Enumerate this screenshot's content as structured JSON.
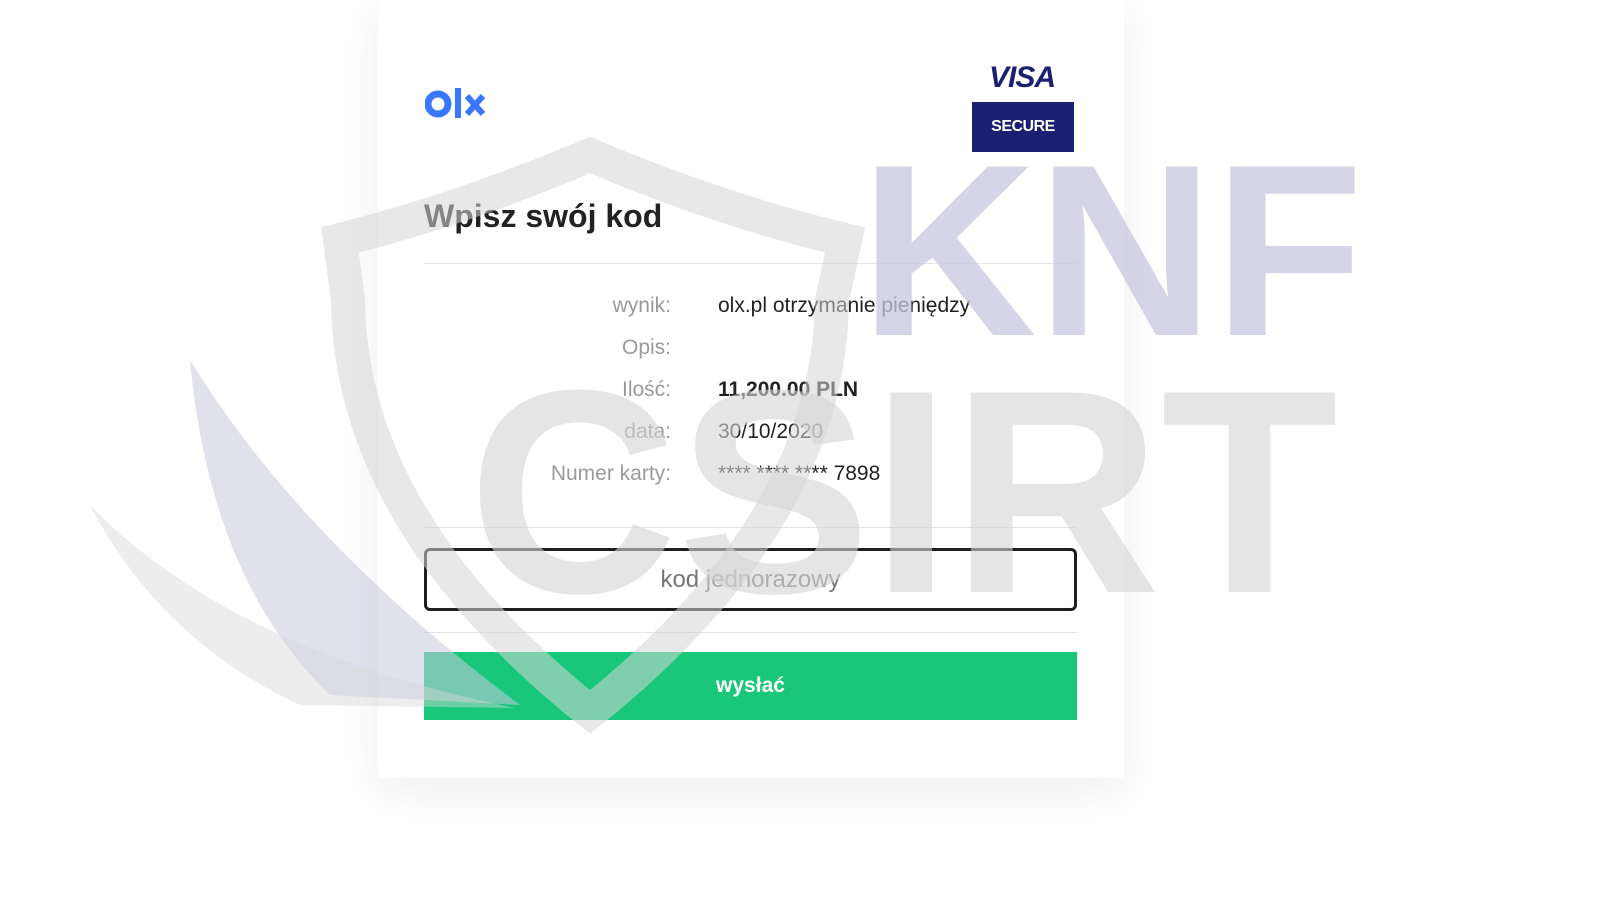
{
  "brand": {
    "merchant_logo": "olx-logo",
    "card_scheme": "VISA",
    "card_scheme_badge": "SECURE",
    "colors": {
      "olx_blue": "#3a77ff",
      "visa_navy": "#1a1f71",
      "button_green": "#19c77a"
    }
  },
  "title": "Wpisz swój kod",
  "details": [
    {
      "label": "wynik:",
      "value": "olx.pl otrzymanie pieniędzy"
    },
    {
      "label": "Opis:",
      "value": ""
    },
    {
      "label": "Ilość:",
      "value": "11,200.00 PLN"
    },
    {
      "label": "data:",
      "value": "30/10/2020"
    },
    {
      "label": "Numer karty:",
      "value": "**** **** **** 7898"
    }
  ],
  "otp": {
    "placeholder": "kod jednorazowy",
    "value": ""
  },
  "submit_label": "wysłać",
  "watermark": {
    "line1": "KNF",
    "line2": "CSIRT",
    "colors": {
      "shield": "#d8d8d8",
      "accent": "#c8c8e0"
    }
  }
}
